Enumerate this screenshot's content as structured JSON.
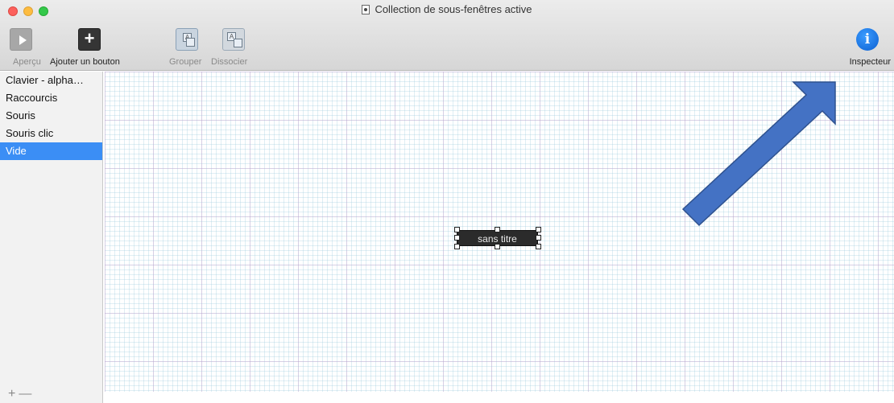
{
  "window": {
    "title": "Collection de sous-fenêtres active"
  },
  "toolbar": {
    "preview_label": "Aperçu",
    "add_button_label": "Ajouter un bouton",
    "group_label": "Grouper",
    "ungroup_label": "Dissocier",
    "inspector_label": "Inspecteur",
    "inspector_glyph": "i",
    "add_glyph": "+"
  },
  "sidebar": {
    "items": [
      {
        "label": "Clavier - alpha…"
      },
      {
        "label": "Raccourcis"
      },
      {
        "label": "Souris"
      },
      {
        "label": "Souris clic"
      },
      {
        "label": "Vide",
        "selected": true
      }
    ],
    "footer_add": "+",
    "footer_remove": "—"
  },
  "canvas": {
    "button_widget_label": "sans titre"
  },
  "colors": {
    "selection": "#3b8ef5",
    "annotation_arrow": "#4472c4",
    "annotation_arrow_stroke": "#2f528f"
  },
  "icons": {
    "preview": "play-icon",
    "add": "plus-icon",
    "group": "group-icon",
    "ungroup": "ungroup-icon",
    "inspector": "info-icon",
    "document": "document-icon"
  }
}
